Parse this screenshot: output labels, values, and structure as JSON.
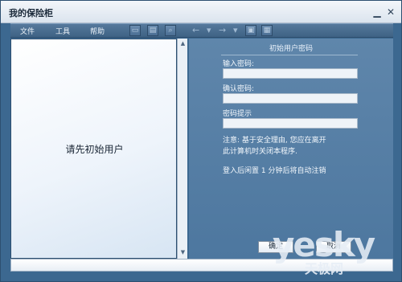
{
  "window": {
    "title": "我的保险柜"
  },
  "menubar": {
    "items": [
      "文件",
      "工具",
      "帮助"
    ]
  },
  "left_panel": {
    "message": "请先初始用户"
  },
  "right_panel": {
    "title": "初始用户密码",
    "fields": [
      {
        "label": "输入密码:",
        "value": "",
        "placeholder": ""
      },
      {
        "label": "确认密码:",
        "value": "",
        "placeholder": ""
      },
      {
        "label": "密码提示",
        "value": "",
        "placeholder": ""
      }
    ],
    "note_line1": "注意: 基于安全理由, 您应在离开",
    "note_line2": "此计算机时关闭本程序.",
    "logout_note": "登入后闲置 1 分钟后将自动注销",
    "buttons": {
      "ok": "确定",
      "cancel": "取消"
    }
  },
  "watermark": {
    "text": "yesky",
    "text_cn": "天极网"
  }
}
